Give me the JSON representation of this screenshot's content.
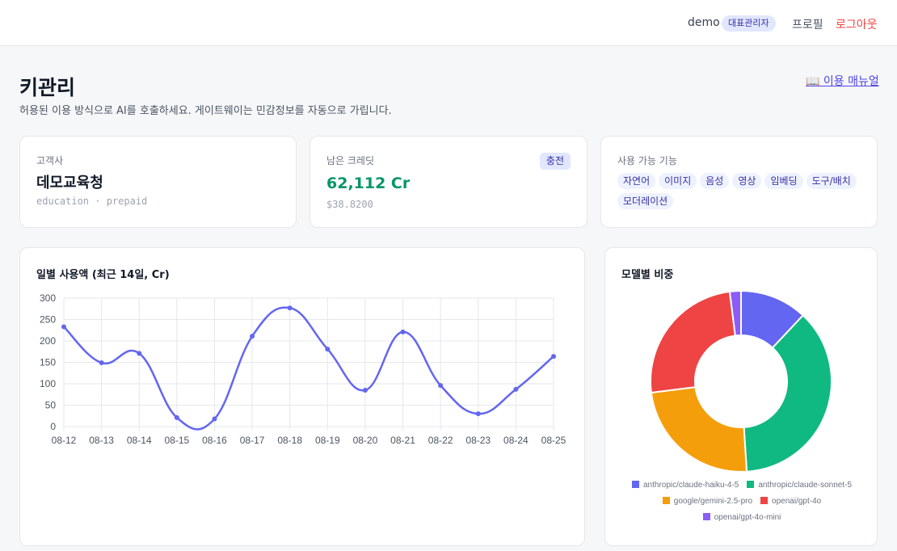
{
  "header": {
    "user": "demo",
    "role_badge": "대표관리자",
    "profile": "프로필",
    "logout": "로그아웃"
  },
  "page": {
    "title": "키관리",
    "subtitle": "허용된 이용 방식으로 AI를 호출하세요. 게이트웨이는 민감정보를 자동으로 가립니다.",
    "manual_link": "📖 이용 매뉴얼"
  },
  "customer": {
    "label": "고객사",
    "name": "데모교육청",
    "meta": "education · prepaid"
  },
  "credit": {
    "label": "남은 크레딧",
    "charge": "충전",
    "value": "62,112 Cr",
    "usd": "$38.8200"
  },
  "features": {
    "label": "사용 가능 기능",
    "items": [
      "자연어",
      "이미지",
      "음성",
      "영상",
      "임베딩",
      "도구/배치",
      "모더레이션"
    ]
  },
  "line_title": "일별 사용액 (최근 14일, Cr)",
  "pie_title": "모델별 비중",
  "colors": {
    "line": "#6366f1",
    "pie": [
      "#6366f1",
      "#10b981",
      "#f59e0b",
      "#ef4444",
      "#8b5cf6"
    ]
  },
  "chart_data": [
    {
      "type": "line",
      "title": "일별 사용액 (최근 14일, Cr)",
      "x": [
        "08-12",
        "08-13",
        "08-14",
        "08-15",
        "08-16",
        "08-17",
        "08-18",
        "08-19",
        "08-20",
        "08-21",
        "08-22",
        "08-23",
        "08-24",
        "08-25"
      ],
      "series": [
        {
          "values": [
            233,
            149,
            171,
            21,
            18,
            211,
            277,
            181,
            85,
            221,
            96,
            30,
            87,
            164
          ]
        }
      ],
      "ylim": [
        0,
        300
      ],
      "yticks": [
        0,
        50,
        100,
        150,
        200,
        250,
        300
      ],
      "grid": true,
      "smooth": true
    },
    {
      "type": "pie",
      "title": "모델별 비중",
      "donut": true,
      "labels": [
        "anthropic/claude-haiku-4-5",
        "anthropic/claude-sonnet-5",
        "google/gemini-2.5-pro",
        "openai/gpt-4o",
        "openai/gpt-4o-mini"
      ],
      "values": [
        12,
        37,
        24,
        25,
        2
      ],
      "legend": "bottom"
    }
  ]
}
